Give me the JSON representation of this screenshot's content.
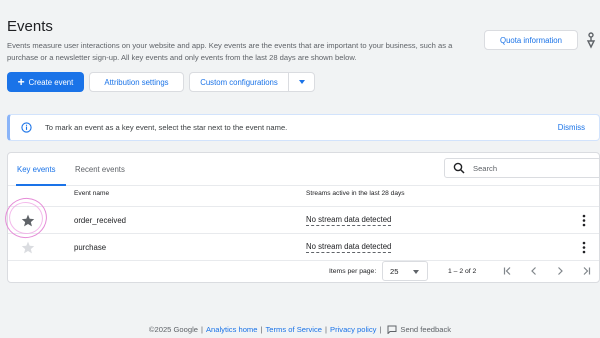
{
  "header": {
    "title": "Events",
    "description": "Events measure user interactions on your website and app. Key events are the events that are important to your business, such as a purchase or a newsletter sign-up. All key events and only events from the last 28 days are shown below.",
    "quota_label": "Quota information"
  },
  "actions": {
    "create_label": "Create event",
    "attribution_label": "Attribution settings",
    "custom_label": "Custom configurations"
  },
  "banner": {
    "text": "To mark an event as a key event, select the star next to the event name.",
    "dismiss_label": "Dismiss"
  },
  "tabs": [
    {
      "label": "Key events",
      "active": true
    },
    {
      "label": "Recent events",
      "active": false
    }
  ],
  "search": {
    "placeholder": "Search",
    "value": ""
  },
  "table": {
    "columns": [
      "Event name",
      "Streams active in the last 28 days"
    ],
    "rows": [
      {
        "name": "order_received",
        "streams": "No stream data detected",
        "key_event": true
      },
      {
        "name": "purchase",
        "streams": "No stream data detected",
        "key_event": false
      }
    ]
  },
  "pagination": {
    "items_per_page_label": "Items per page:",
    "items_per_page": "25",
    "range": "1 – 2 of 2"
  },
  "footer": {
    "copyright": "©2025 Google",
    "links": [
      "Analytics home",
      "Terms of Service",
      "Privacy policy"
    ],
    "feedback": "Send feedback"
  },
  "colors": {
    "accent": "#1a73e8",
    "star_active": "#5f6368",
    "star_inactive": "#dadce0",
    "annotation": "#e58bd7"
  }
}
